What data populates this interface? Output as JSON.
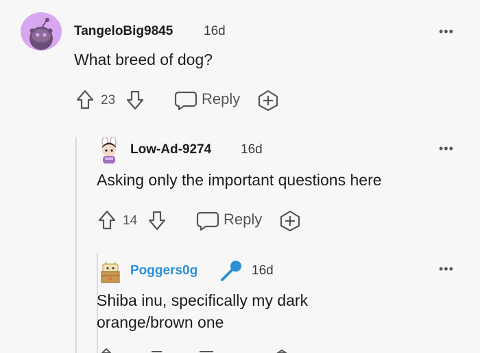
{
  "comments": [
    {
      "username": "TangeloBig9845",
      "time": "16d",
      "text": "What breed of dog?",
      "score": "23",
      "reply_label": "Reply",
      "avatar": "snoo-default-avatar"
    },
    {
      "username": "Low-Ad-9274",
      "time": "16d",
      "text": "Asking only the important questions here",
      "score": "14",
      "reply_label": "Reply",
      "avatar": "bunny-hat-avatar"
    },
    {
      "username": "Poggers0g",
      "time": "16d",
      "text_line1": "Shiba inu, specifically my dark",
      "text_line2": "orange/brown one",
      "badge": "microphone-icon",
      "avatar": "box-cat-avatar",
      "username_color": "#2b8fd6"
    }
  ],
  "menu_glyph": "•••",
  "colors": {
    "background": "#f7f7f7",
    "accent": "#2b8fd6",
    "avatar_bg": "#d8a7f2"
  }
}
